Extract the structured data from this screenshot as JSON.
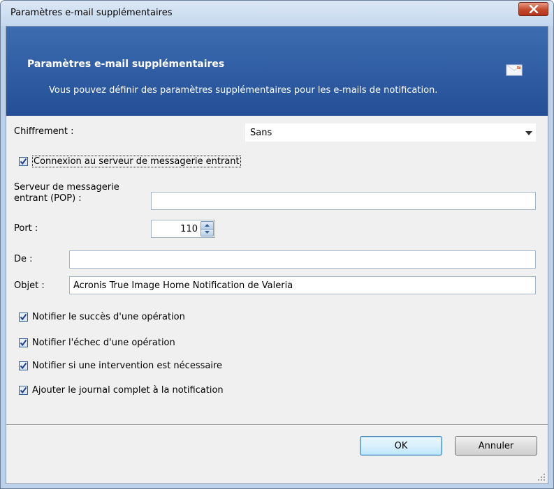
{
  "window": {
    "title": "Paramètres e-mail supplémentaires"
  },
  "banner": {
    "heading": "Paramètres e-mail supplémentaires",
    "description": "Vous pouvez définir des paramètres supplémentaires pour les e-mails de notification."
  },
  "encryption": {
    "label": "Chiffrement :",
    "value": "Sans"
  },
  "incoming": {
    "checkbox_label": "Connexion au serveur de messagerie entrant",
    "checked": true,
    "server_label_line1": "Serveur de messagerie",
    "server_label_line2": "entrant (POP) :",
    "server_value": "",
    "port_label": "Port :",
    "port_value": "110"
  },
  "message": {
    "from_label": "De :",
    "from_value": "",
    "subject_label": "Objet :",
    "subject_value": "Acronis True Image Home Notification de Valeria"
  },
  "options": [
    {
      "label": "Notifier le succès d'une opération",
      "checked": true
    },
    {
      "label": "Notifier l'échec d'une opération",
      "checked": true
    },
    {
      "label": "Notifier si une intervention est nécessaire",
      "checked": true
    },
    {
      "label": "Ajouter le journal complet à la notification",
      "checked": true
    }
  ],
  "buttons": {
    "ok": "OK",
    "cancel": "Annuler"
  },
  "icons": {
    "close": "close-icon",
    "mail": "mail-icon",
    "dropdown": "chevron-down-icon",
    "resize": "resize-grip-icon"
  }
}
